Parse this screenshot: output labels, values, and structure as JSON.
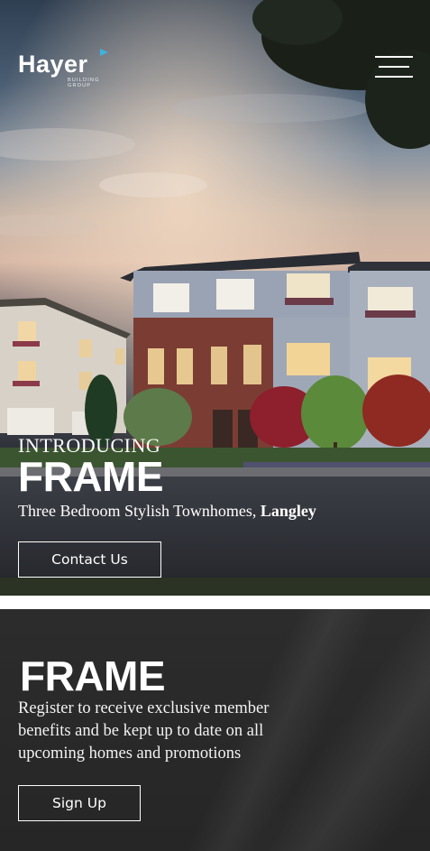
{
  "header": {
    "logo_text": "Hayer",
    "logo_subtext": "BUILDING GROUP",
    "menu_icon": "hamburger-menu-icon"
  },
  "hero": {
    "intro": "INTRODUCING",
    "title": "FRAME",
    "tagline_prefix": "Three Bedroom Stylish Townhomes, ",
    "tagline_location": "Langley",
    "contact_label": "Contact Us"
  },
  "register": {
    "title": "FRAME",
    "description": "Register to receive exclusive member benefits and be kept up to date on all upcoming homes and promotions",
    "signup_label": "Sign Up"
  },
  "colors": {
    "panel_bg": "#2a2a2a",
    "logo_accent": "#3fb3e0",
    "text": "#ffffff"
  }
}
